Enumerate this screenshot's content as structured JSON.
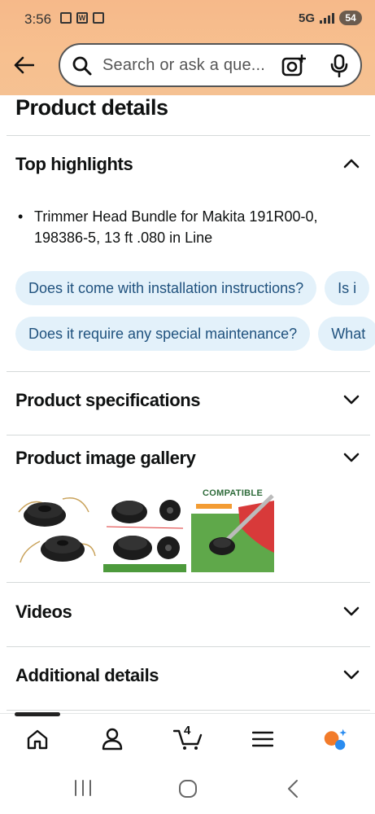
{
  "status_bar": {
    "time": "3:56",
    "network": "5G",
    "battery": "54"
  },
  "search": {
    "placeholder": "Search or ask a que..."
  },
  "page": {
    "title": "Product details"
  },
  "sections": {
    "top_highlights": {
      "title": "Top highlights",
      "bullets": [
        "Trimmer Head Bundle for Makita 191R00-0, 198386-5, 13 ft .080 in Line"
      ],
      "chips_row1": [
        "Does it come with installation instructions?",
        "Is i"
      ],
      "chips_row2": [
        "Does it require any special maintenance?",
        "What"
      ]
    },
    "product_specifications": {
      "title": "Product specifications"
    },
    "product_image_gallery": {
      "title": "Product image gallery",
      "thumb3_caption": "COMPATIBLE"
    },
    "videos": {
      "title": "Videos"
    },
    "additional_details": {
      "title": "Additional details"
    }
  },
  "bottom_nav": {
    "cart_count": "4",
    "items": [
      "home-icon",
      "account-icon",
      "cart-icon",
      "menu-icon",
      "rufus-icon"
    ]
  },
  "colors": {
    "header_gradient": "#f7c08f",
    "chip_bg": "#e3f1fa",
    "chip_text": "#20527e",
    "divider": "#d5d9d9"
  }
}
